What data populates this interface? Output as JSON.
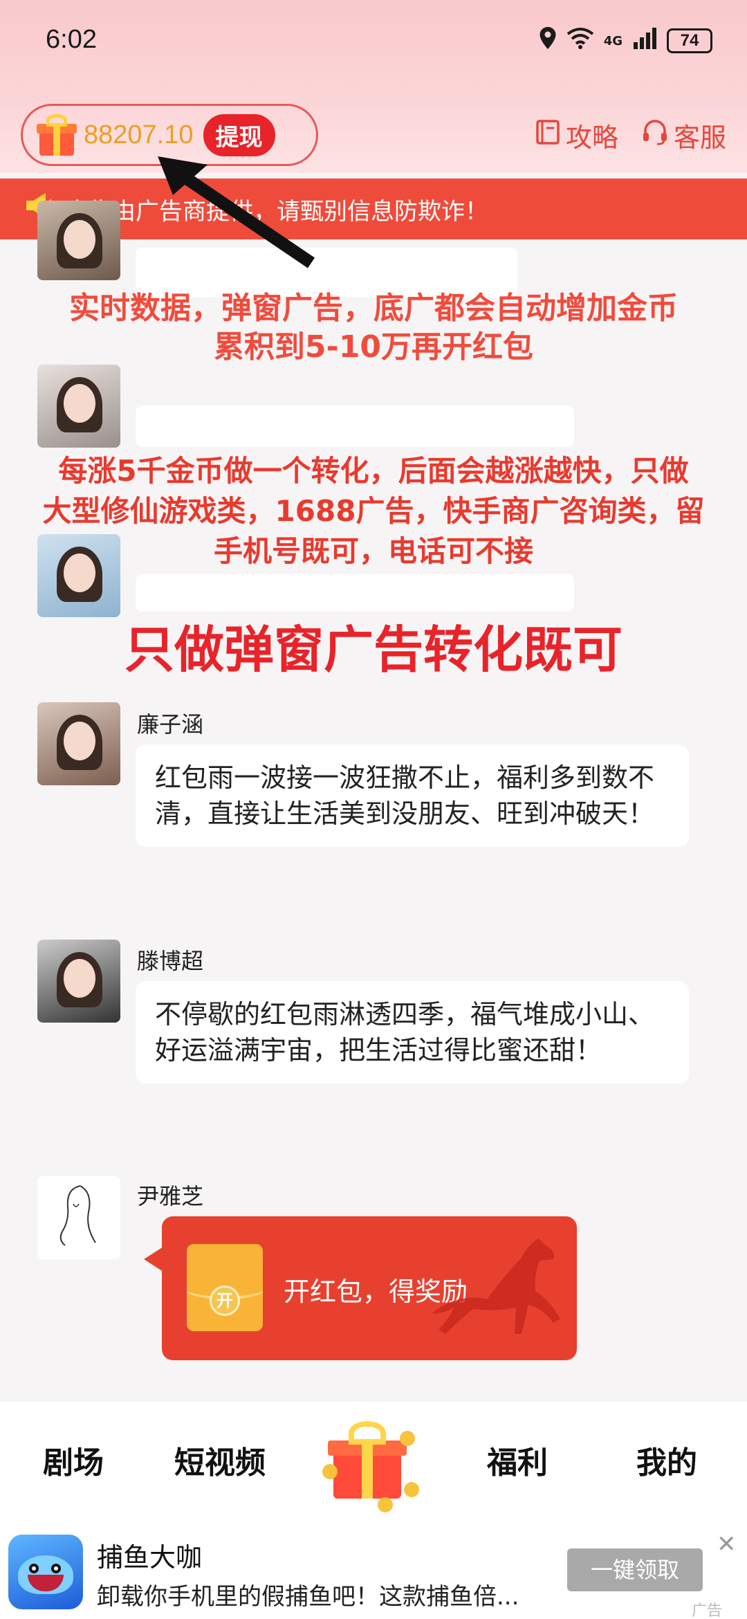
{
  "status_bar": {
    "time": "6:02",
    "network_label": "4G",
    "battery": "74"
  },
  "header": {
    "coin_amount": "88207.10",
    "withdraw_label": "提现",
    "guide_label": "攻略",
    "service_label": "客服"
  },
  "notice": {
    "text": "广告由广告商提供，请甄别信息防欺诈！"
  },
  "annotations": {
    "line1a": "实时数据，弹窗广告，底广都会自动增加金币",
    "line1b": "累积到5-10万再开红包",
    "line2a": "每涨5千金币做一个转化，后面会越涨越快，只做",
    "line2b": "大型修仙游戏类，1688广告，快手商广咨询类，留",
    "line2c": "手机号既可，电话可不接",
    "line3": "只做弹窗广告转化既可"
  },
  "messages": [
    {
      "name": "廉子涵",
      "text": "红包雨一波接一波狂撒不止，福利多到数不清，直接让生活美到没朋友、旺到冲破天！"
    },
    {
      "name": "滕博超",
      "text": "不停歇的红包雨淋透四季，福气堆成小山、好运溢满宇宙，把生活过得比蜜还甜！"
    },
    {
      "name": "尹雅芝"
    }
  ],
  "red_envelope": {
    "coin_char": "开",
    "label": "开红包，得奖励"
  },
  "tabs": [
    "剧场",
    "短视频",
    "福利",
    "我的"
  ],
  "ad": {
    "title": "捕鱼大咖",
    "description": "卸载你手机里的假捕鱼吧！这款捕鱼倍...",
    "button": "一键领取",
    "close": "✕",
    "tag": "广告"
  },
  "colors": {
    "accent": "#e8232a",
    "notice_bg": "#ef4b3b",
    "coin_text": "#e9a022"
  }
}
